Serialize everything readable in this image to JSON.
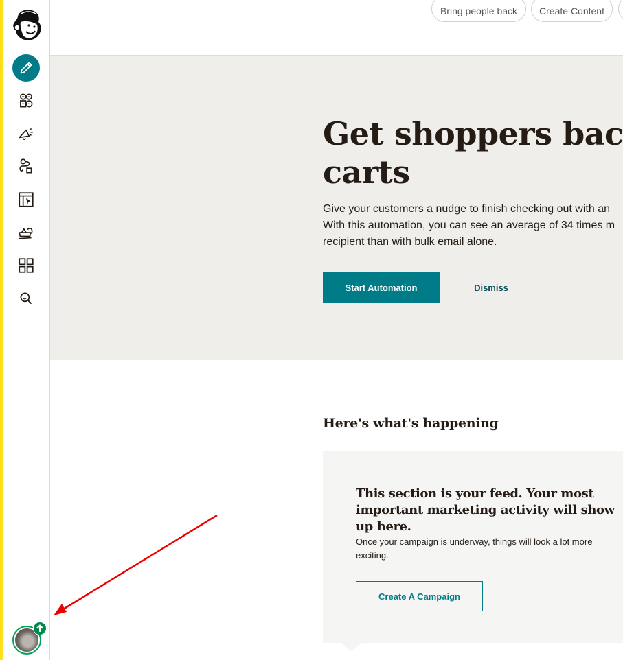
{
  "sidebar": {
    "logo": "mailchimp-freddie-logo",
    "items": [
      {
        "name": "create",
        "icon": "pencil-icon",
        "active": true
      },
      {
        "name": "audience",
        "icon": "audience-icon",
        "active": false
      },
      {
        "name": "campaigns",
        "icon": "megaphone-icon",
        "active": false
      },
      {
        "name": "automations",
        "icon": "automation-flow-icon",
        "active": false
      },
      {
        "name": "website",
        "icon": "website-icon",
        "active": false
      },
      {
        "name": "content-studio",
        "icon": "content-studio-icon",
        "active": false
      },
      {
        "name": "integrations",
        "icon": "grid-icon",
        "active": false
      },
      {
        "name": "search",
        "icon": "search-icon",
        "active": false
      }
    ],
    "account": {
      "avatar": "user-avatar",
      "badge": "upgrade-arrow-icon"
    }
  },
  "topbar": {
    "chips": [
      {
        "label": "Bring people back"
      },
      {
        "label": "Create Content"
      },
      {
        "label": ""
      }
    ]
  },
  "hero": {
    "title_line1": "Get shoppers back to",
    "title_line2": "carts",
    "body_line1": "Give your customers a nudge to finish checking out with an",
    "body_line2": "With this automation, you can see an average of 34 times m",
    "body_line3": "recipient than with bulk email alone.",
    "primary_button": "Start Automation",
    "secondary_button": "Dismiss"
  },
  "feed": {
    "title": "Here's what's happening",
    "heading": "This section is your feed. Your most important marketing activity will show up here.",
    "subtext": "Once your campaign is underway, things will look a lot more exciting.",
    "button": "Create A Campaign"
  },
  "colors": {
    "brand_teal": "#007c89",
    "accent_yellow": "#ffe01b",
    "hero_bg": "#efeeea",
    "feed_bg": "#f5f5f3",
    "upgrade_green": "#00894b",
    "annotation_red": "#ee0000"
  }
}
